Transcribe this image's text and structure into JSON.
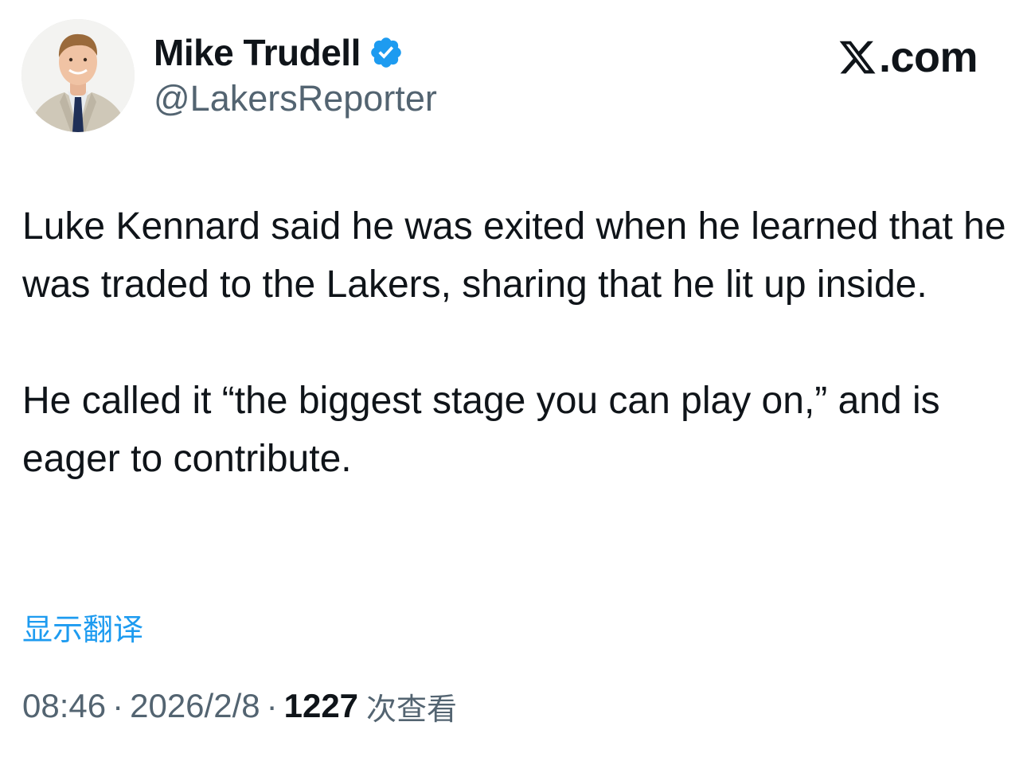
{
  "author": {
    "display_name": "Mike Trudell",
    "handle": "@LakersReporter",
    "verified": true,
    "avatar_icon": "profile-photo"
  },
  "brand": {
    "label": ".com",
    "logo_icon": "x-logo-icon"
  },
  "tweet": {
    "paragraphs": [
      "Luke Kennard said he was exited when he learned that he was traded to the Lakers, sharing that he lit up inside.",
      "He called it “the biggest stage you can play on,” and is eager to contribute."
    ]
  },
  "actions": {
    "translate_label": "显示翻译"
  },
  "meta": {
    "time": "08:46",
    "separator": "·",
    "date": "2026/2/8",
    "views_count": "1227",
    "views_label": "次查看"
  },
  "colors": {
    "text_primary": "#0f1419",
    "text_secondary": "#536471",
    "accent": "#1d9bf0",
    "verified_badge": "#1d9bf0"
  }
}
